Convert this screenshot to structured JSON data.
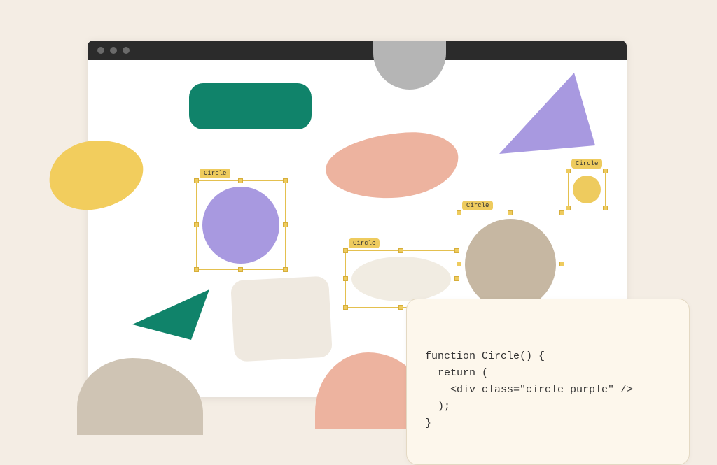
{
  "selections": {
    "purple_circle": {
      "label": "Circle"
    },
    "cream_ellipse": {
      "label": "Circle"
    },
    "tan_circle": {
      "label": "Circle"
    },
    "yellow_circle": {
      "label": "Circle"
    }
  },
  "code": {
    "line1": "function Circle() {",
    "line2": "return (",
    "line3": "<div class=\"circle purple\" />",
    "line4": ");",
    "line5": "}"
  },
  "colors": {
    "background": "#f4ede4",
    "titlebar": "#2b2b2b",
    "handle": "#eecb5e",
    "green": "#10836a",
    "purple": "#a899e0",
    "pink": "#edb39f",
    "yellow": "#f2cd5d",
    "tan": "#c6b7a2"
  }
}
